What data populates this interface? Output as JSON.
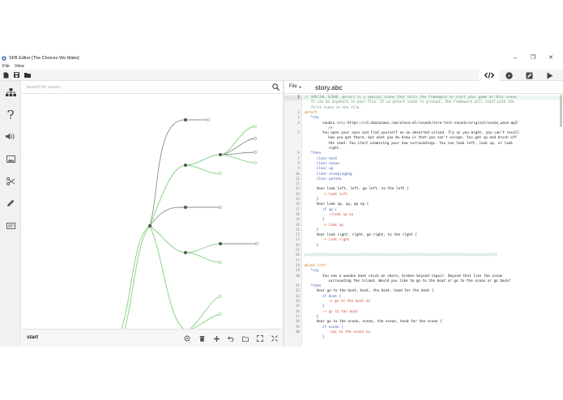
{
  "window": {
    "title": "SFB Editor [The Choices We Make]",
    "controls": [
      "–",
      "❐",
      "✕"
    ]
  },
  "menu": [
    "File",
    "View"
  ],
  "toolbar": {
    "left_icons": [
      "new-file-icon",
      "save-icon",
      "open-folder-icon"
    ],
    "modes": [
      "code-icon",
      "compass-icon",
      "edit-icon",
      "play-icon"
    ],
    "active_mode": "code-icon"
  },
  "sidebar": {
    "icons": [
      "hierarchy-icon",
      "help-icon",
      "audio-icon",
      "image-icon",
      "scissors-icon",
      "pen-icon",
      "card-icon"
    ]
  },
  "graph": {
    "search_placeholder": "Search for scene...",
    "current_scene": "start",
    "tools": [
      "target-icon",
      "trash-icon",
      "add-icon",
      "undo-icon",
      "folder-icon",
      "expand-icon",
      "fullscreen-icon"
    ]
  },
  "editor": {
    "file_menu": "File",
    "filename": "story.abc",
    "lines": [
      {
        "n": "1",
        "indent": 0,
        "cls": "c-comment",
        "t": "// SPECIAL SCENE: @start is a special scene that tells the framework to start your game at this scene."
      },
      {
        "n": "",
        "indent": 0,
        "cls": "c-comment",
        "t": "   It can be anywhere in your file. If no @start scene is present, the framework will start with the"
      },
      {
        "n": "",
        "indent": 0,
        "cls": "c-comment",
        "t": "   first scene in the file."
      },
      {
        "n": "2",
        "indent": 0,
        "cls": "c-scene",
        "t": "@start"
      },
      {
        "n": "3",
        "indent": 1,
        "cls": "c-kw",
        "t": "*say"
      },
      {
        "n": "4",
        "indent": 3,
        "cls": "c-text",
        "t": "<audio src='https://s3.amazonaws.com/alexa-ml/sounds/ezra-test-sounds/original/ocean_wave.mp3'"
      },
      {
        "n": "",
        "indent": 4,
        "cls": "c-text",
        "t": "/>"
      },
      {
        "n": "5",
        "indent": 3,
        "cls": "c-text",
        "t": "You open your eyes and find yourself on an deserted island. Try as you might, you can't recall"
      },
      {
        "n": "",
        "indent": 4,
        "cls": "c-text",
        "t": "how you got there, but what you do know is that you can't escape. You get up and brush off"
      },
      {
        "n": "",
        "indent": 4,
        "cls": "c-text",
        "t": "the sand. You start examining your new surroundings. You can look left, look up, or look"
      },
      {
        "n": "",
        "indent": 4,
        "cls": "c-text",
        "t": "right."
      },
      {
        "n": "6",
        "indent": 1,
        "cls": "c-kw",
        "t": "*then"
      },
      {
        "n": "7",
        "indent": 2,
        "cls": "c-kw",
        "t": "clear boat"
      },
      {
        "n": "8",
        "indent": 2,
        "cls": "c-kw",
        "t": "clear ocean"
      },
      {
        "n": "9",
        "indent": 2,
        "cls": "c-kw",
        "t": "clear up"
      },
      {
        "n": "10",
        "indent": 2,
        "cls": "c-kw",
        "t": "clear sleepingbag"
      },
      {
        "n": "11",
        "indent": 2,
        "cls": "c-kw",
        "t": "clear potato"
      },
      {
        "n": "12",
        "indent": 0,
        "cls": "c-text",
        "t": ""
      },
      {
        "n": "13",
        "indent": 2,
        "cls": "c-text",
        "t": "hear look left, left, go left, to the left {"
      },
      {
        "n": "14",
        "indent": 3,
        "cls": "c-arrow",
        "t": "-> look left"
      },
      {
        "n": "15",
        "indent": 2,
        "cls": "c-text",
        "t": "}"
      },
      {
        "n": "16",
        "indent": 2,
        "cls": "c-text",
        "t": "hear look up, up, go up {"
      },
      {
        "n": "17",
        "indent": 3,
        "cls": "c-kw",
        "t": "if up {"
      },
      {
        "n": "18",
        "indent": 4,
        "cls": "c-arrow",
        "t": "->look up no"
      },
      {
        "n": "19",
        "indent": 3,
        "cls": "c-text",
        "t": "}"
      },
      {
        "n": "20",
        "indent": 3,
        "cls": "c-arrow",
        "t": "-> look up"
      },
      {
        "n": "21",
        "indent": 2,
        "cls": "c-text",
        "t": "}"
      },
      {
        "n": "22",
        "indent": 2,
        "cls": "c-text",
        "t": "hear look right, right, go right, to the right {"
      },
      {
        "n": "23",
        "indent": 3,
        "cls": "c-arrow",
        "t": "-> look right"
      },
      {
        "n": "24",
        "indent": 2,
        "cls": "c-text",
        "t": "}"
      },
      {
        "n": "25",
        "indent": 0,
        "cls": "c-text",
        "t": ""
      },
      {
        "n": "26",
        "indent": 0,
        "cls": "c-comment",
        "t": "////////////////////////////////////////////////////////////////////////////////////////////"
      },
      {
        "n": "27",
        "indent": 0,
        "cls": "c-text",
        "t": ""
      },
      {
        "n": "28",
        "indent": 0,
        "cls": "c-scene",
        "t": "@look left"
      },
      {
        "n": "29",
        "indent": 1,
        "cls": "c-kw",
        "t": "*say"
      },
      {
        "n": "30",
        "indent": 3,
        "cls": "c-text",
        "t": "You see a wooden boat stuck on shore, broken beyond repair. Beyond that lies the ocean"
      },
      {
        "n": "",
        "indent": 4,
        "cls": "c-text",
        "t": "surrounding the island. Would you like to go to the boat or go to the ocean or go back?"
      },
      {
        "n": "31",
        "indent": 1,
        "cls": "c-kw",
        "t": "*then"
      },
      {
        "n": "32",
        "indent": 2,
        "cls": "c-text",
        "t": "hear go to the boat, boat, the boat, head for the boat {"
      },
      {
        "n": "33",
        "indent": 3,
        "cls": "c-kw",
        "t": "if boat {"
      },
      {
        "n": "34",
        "indent": 4,
        "cls": "c-arrow",
        "t": "-> go to the boat no"
      },
      {
        "n": "35",
        "indent": 3,
        "cls": "c-text",
        "t": "}"
      },
      {
        "n": "36",
        "indent": 3,
        "cls": "c-arrow",
        "t": "-> go to the boat"
      },
      {
        "n": "37",
        "indent": 2,
        "cls": "c-text",
        "t": "}"
      },
      {
        "n": "38",
        "indent": 2,
        "cls": "c-text",
        "t": "hear go to the ocean, ocean, the ocean, head for the ocean {"
      },
      {
        "n": "39",
        "indent": 3,
        "cls": "c-kw",
        "t": "if ocean {"
      },
      {
        "n": "40",
        "indent": 4,
        "cls": "c-arrow",
        "t": "->go to the ocean no"
      },
      {
        "n": "",
        "indent": 3,
        "cls": "c-text",
        "t": "}"
      }
    ]
  },
  "colors": {
    "green_edge": "#7ed07e",
    "gray_edge": "#8c8c8c",
    "node_fill": "#555555"
  }
}
